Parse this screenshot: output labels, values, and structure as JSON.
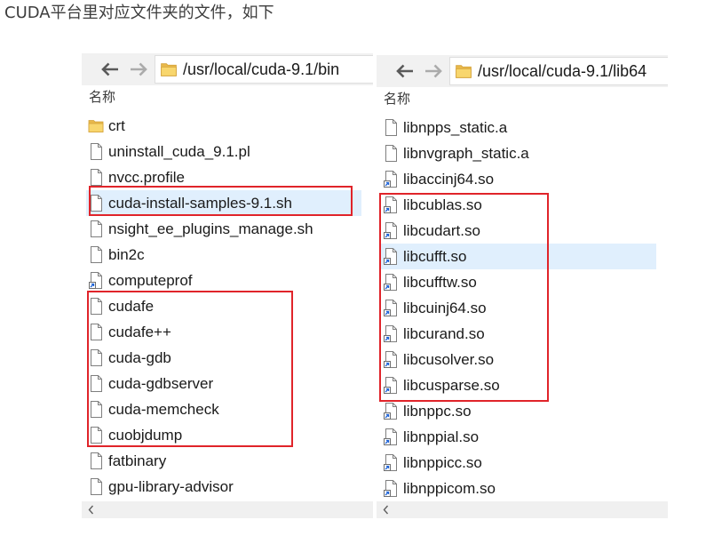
{
  "intro_text": "CUDA平台里对应文件夹的文件，如下",
  "colors": {
    "annotation_red": "#e0242a",
    "selection_blue": "#e0effd",
    "folder_yellow": "#f8d66d"
  },
  "left_pane": {
    "address_bar": {
      "back_icon": "arrow-left-icon",
      "forward_icon": "arrow-right-icon",
      "location_icon": "folder-icon",
      "path": "/usr/local/cuda-9.1/bin"
    },
    "column_header": "名称",
    "files": [
      {
        "name": "crt",
        "icon": "folder-icon"
      },
      {
        "name": "uninstall_cuda_9.1.pl",
        "icon": "file-icon"
      },
      {
        "name": "nvcc.profile",
        "icon": "file-icon"
      },
      {
        "name": "cuda-install-samples-9.1.sh",
        "icon": "file-icon",
        "selected": true,
        "boxed": true
      },
      {
        "name": "nsight_ee_plugins_manage.sh",
        "icon": "file-icon"
      },
      {
        "name": "bin2c",
        "icon": "file-icon"
      },
      {
        "name": "computeprof",
        "icon": "shortcut-file-icon"
      },
      {
        "name": "cudafe",
        "icon": "file-icon",
        "boxed": true
      },
      {
        "name": "cudafe++",
        "icon": "file-icon",
        "boxed": true
      },
      {
        "name": "cuda-gdb",
        "icon": "file-icon",
        "boxed": true
      },
      {
        "name": "cuda-gdbserver",
        "icon": "file-icon",
        "boxed": true
      },
      {
        "name": "cuda-memcheck",
        "icon": "file-icon",
        "boxed": true
      },
      {
        "name": "cuobjdump",
        "icon": "file-icon",
        "boxed": true
      },
      {
        "name": "fatbinary",
        "icon": "file-icon"
      },
      {
        "name": "gpu-library-advisor",
        "icon": "file-icon"
      }
    ],
    "scroll_icon": "chevron-left-icon"
  },
  "right_pane": {
    "address_bar": {
      "back_icon": "arrow-left-icon",
      "forward_icon": "arrow-right-icon",
      "location_icon": "folder-icon",
      "path": "/usr/local/cuda-9.1/lib64"
    },
    "column_header": "名称",
    "files": [
      {
        "name": "libnpps_static.a",
        "icon": "file-icon"
      },
      {
        "name": "libnvgraph_static.a",
        "icon": "file-icon"
      },
      {
        "name": "libaccinj64.so",
        "icon": "shortcut-file-icon"
      },
      {
        "name": "libcublas.so",
        "icon": "shortcut-file-icon",
        "boxed": true
      },
      {
        "name": "libcudart.so",
        "icon": "shortcut-file-icon",
        "boxed": true
      },
      {
        "name": "libcufft.so",
        "icon": "shortcut-file-icon",
        "boxed": true,
        "selected": true
      },
      {
        "name": "libcufftw.so",
        "icon": "shortcut-file-icon",
        "boxed": true
      },
      {
        "name": "libcuinj64.so",
        "icon": "shortcut-file-icon",
        "boxed": true
      },
      {
        "name": "libcurand.so",
        "icon": "shortcut-file-icon",
        "boxed": true
      },
      {
        "name": "libcusolver.so",
        "icon": "shortcut-file-icon",
        "boxed": true
      },
      {
        "name": "libcusparse.so",
        "icon": "shortcut-file-icon",
        "boxed": true
      },
      {
        "name": "libnppc.so",
        "icon": "shortcut-file-icon"
      },
      {
        "name": "libnppial.so",
        "icon": "shortcut-file-icon"
      },
      {
        "name": "libnppicc.so",
        "icon": "shortcut-file-icon"
      },
      {
        "name": "libnppicom.so",
        "icon": "shortcut-file-icon"
      }
    ],
    "scroll_icon": "chevron-left-icon"
  }
}
